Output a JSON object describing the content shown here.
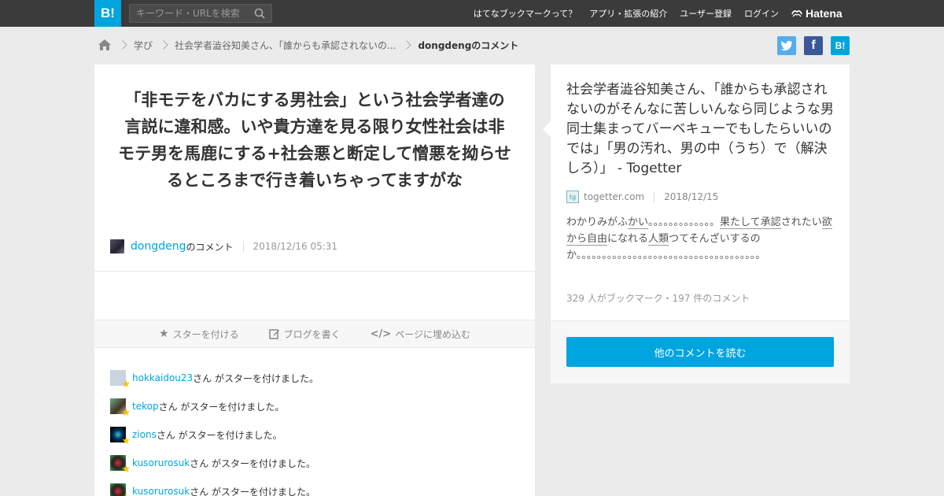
{
  "header": {
    "logo": "B!",
    "search_placeholder": "キーワード・URLを検索",
    "nav": [
      "はてなブックマークって？",
      "アプリ・拡張の紹介",
      "ユーザー登録",
      "ログイン"
    ],
    "brand": "Hatena"
  },
  "breadcrumb": {
    "items": [
      "学び",
      "社会学者澁谷知美さん、「誰からも承認されないの...",
      "dongdengのコメント"
    ]
  },
  "share": {
    "twitter_label": "t",
    "facebook_label": "f",
    "hatena_label": "B!"
  },
  "comment": {
    "text": "「非モテをバカにする男社会」という社会学者達の言説に違和感。いや貴方達を見る限り女性社会は非モテ男を馬鹿にする+社会悪と断定して憎悪を拗らせるところまで行き着いちゃってますがな",
    "username": "dongdeng",
    "suffix": "のコメント",
    "datetime": "2018/12/16 05:31"
  },
  "actions": {
    "star": "スターを付ける",
    "blog": "ブログを書く",
    "embed": "ページに埋め込む"
  },
  "stars": {
    "suffix": "さん がスターを付けました。",
    "users": [
      "hokkaidou23",
      "tekop",
      "zions",
      "kusorurosuk",
      "kusorurosuk"
    ]
  },
  "entry": {
    "title": "社会学者澁谷知美さん、「誰からも承認されないのがそんなに苦しいんなら同じような男同士集まってバーベキューでもしたらいいのでは」「男の汚れ、男の中（うち）で（解決しろ）」 - Togetter",
    "domain": "togetter.com",
    "date": "2018/12/15",
    "summary_parts": [
      "わかりみがふ",
      "かい",
      "。。。。。。。。。。。。。",
      "果たして",
      "承認",
      "されたい",
      "欲",
      "から",
      "自由",
      "になれる",
      "人類",
      "つてそんざいするのか。。。。。。。。。。。。。。。。。。。。。。。。。。。。。。。。。。。。"
    ],
    "counts": "329 人がブックマーク・197 件のコメント",
    "read_more": "他のコメントを読む"
  },
  "colors": {
    "accent": "#00a4de",
    "header_bg": "#3b3b3b",
    "twitter": "#55acee",
    "facebook": "#3b5998",
    "star": "#f5c400"
  }
}
